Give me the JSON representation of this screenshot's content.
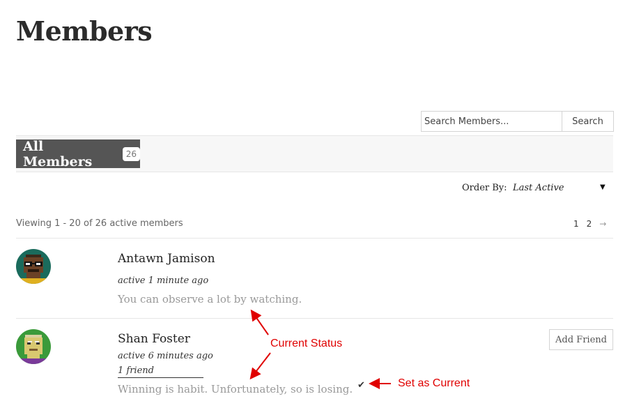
{
  "page": {
    "title": "Members"
  },
  "search": {
    "placeholder": "Search Members...",
    "button_label": "Search"
  },
  "tabs": {
    "all_members_label": "All Members",
    "all_members_count": "26"
  },
  "order": {
    "label": "Order By:",
    "selected": "Last Active",
    "caret": "▼"
  },
  "listing": {
    "viewing_text": "Viewing 1 - 20 of 26 active members"
  },
  "pagination": {
    "pages": [
      "1",
      "2"
    ],
    "next": "→"
  },
  "members": [
    {
      "name": "Antawn Jamison",
      "active": "active 1 minute ago",
      "status": "You can observe a lot by watching."
    },
    {
      "name": "Shan Foster",
      "active": "active 6 minutes ago",
      "friends": "1 friend",
      "status": "Winning is habit. Unfortunately, so is losing.",
      "action_label": "Add Friend"
    }
  ],
  "annotations": {
    "current_status": "Current Status",
    "set_as_current": "Set as Current",
    "color": "#e00000"
  }
}
